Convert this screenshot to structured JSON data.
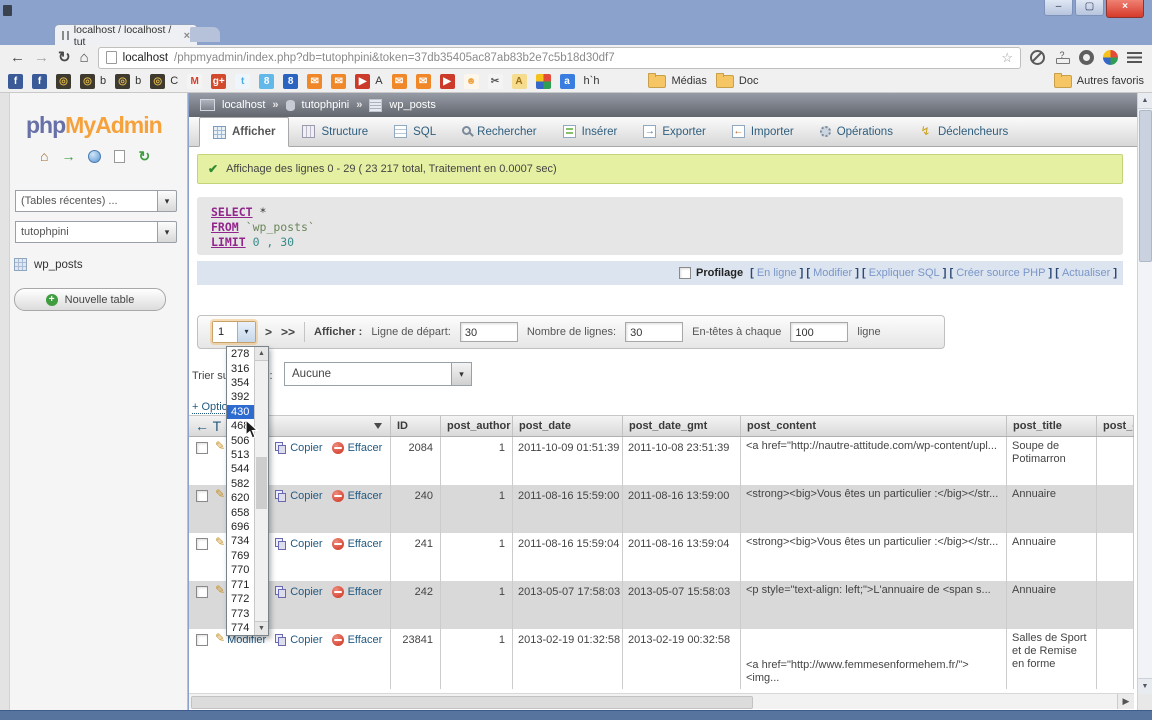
{
  "window": {
    "tab_title": "localhost / localhost / tut",
    "tab_close": "×",
    "minimize": "–",
    "maximize": "▢",
    "close": "×"
  },
  "browser": {
    "url_host": "localhost",
    "url_rest": "/phpmyadmin/index.php?db=tutophpini&token=37db35405ac87ab83b2e7c5b18d30df7",
    "bookmarks": [
      {
        "glyph": "f",
        "bg": "#3a5a98",
        "fg": "#ffffff"
      },
      {
        "glyph": "f",
        "bg": "#3a5a98",
        "fg": "#ffffff"
      },
      {
        "glyph": "◎",
        "bg": "#3f3a30",
        "fg": "#d8b44a"
      },
      {
        "glyph": "◎",
        "bg": "#3f3a30",
        "fg": "#d8b44a",
        "label": "b"
      },
      {
        "glyph": "◎",
        "bg": "#3f3a30",
        "fg": "#d8b44a",
        "label": "b"
      },
      {
        "glyph": "◎",
        "bg": "#3f3a30",
        "fg": "#d8b44a",
        "label": "C"
      },
      {
        "glyph": "M",
        "bg": "#f4f4f4",
        "fg": "#d43f2a"
      },
      {
        "glyph": "g+",
        "bg": "#d3492c",
        "fg": "#ffffff"
      },
      {
        "glyph": "t",
        "bg": "#eef6fc",
        "fg": "#4aabe4"
      },
      {
        "glyph": "8",
        "bg": "#62b8e8",
        "fg": "#ffffff"
      },
      {
        "glyph": "8",
        "bg": "#2a63c0",
        "fg": "#ffffff"
      },
      {
        "glyph": "✉",
        "bg": "#f0882a",
        "fg": "#ffffff"
      },
      {
        "glyph": "✉",
        "bg": "#f0882a",
        "fg": "#ffffff"
      },
      {
        "glyph": "▶",
        "bg": "#cc3a2a",
        "fg": "#ffffff",
        "label": "A"
      },
      {
        "glyph": "✉",
        "bg": "#f0882a",
        "fg": "#ffffff"
      },
      {
        "glyph": "✉",
        "bg": "#f0882a",
        "fg": "#ffffff"
      },
      {
        "glyph": "▶",
        "bg": "#cc3a2a",
        "fg": "#ffffff"
      },
      {
        "glyph": "☻",
        "bg": "#fdf6ec",
        "fg": "#f0a23a"
      },
      {
        "glyph": "✂",
        "bg": "#f4f4f4",
        "fg": "#555555"
      },
      {
        "glyph": "A",
        "bg": "#f6dc8e",
        "fg": "#a07010"
      },
      {
        "type": "grid"
      },
      {
        "glyph": "a",
        "bg": "#3a7de0",
        "fg": "#ffffff"
      },
      {
        "type": "text",
        "label": "h`h"
      }
    ],
    "folder_medias": "Médias",
    "folder_doc": "Doc",
    "other_favorites": "Autres favoris"
  },
  "sidebar": {
    "logo_php": "php",
    "logo_myadmin": "MyAdmin",
    "recent_tables": "(Tables récentes) ...",
    "database": "tutophpini",
    "table": "wp_posts",
    "new_table": "Nouvelle table"
  },
  "breadcrumb": {
    "server": "localhost",
    "sep": "»",
    "database": "tutophpini",
    "table": "wp_posts"
  },
  "tabs": [
    {
      "label": "Afficher",
      "icon": "browse",
      "active": true
    },
    {
      "label": "Structure",
      "icon": "structure"
    },
    {
      "label": "SQL",
      "icon": "sql"
    },
    {
      "label": "Rechercher",
      "icon": "search"
    },
    {
      "label": "Insérer",
      "icon": "insert"
    },
    {
      "label": "Exporter",
      "icon": "export"
    },
    {
      "label": "Importer",
      "icon": "import"
    },
    {
      "label": "Opérations",
      "icon": "ops"
    },
    {
      "label": "Déclencheurs",
      "icon": "triggers"
    }
  ],
  "message": "Affichage des lignes 0 - 29 ( 23 217 total, Traitement en 0.0007 sec)",
  "sql": {
    "kw_select": "SELECT",
    "star": "*",
    "kw_from": "FROM",
    "table": "`wp_posts`",
    "kw_limit": "LIMIT",
    "args": "0 , 30"
  },
  "profiling": {
    "label": "Profilage",
    "links": [
      "En ligne",
      "Modifier",
      "Expliquer SQL",
      "Créer source PHP",
      "Actualiser"
    ]
  },
  "pagination": {
    "select_value": "1",
    "next_label": ">",
    "last_label": ">>",
    "afficher_label": "Afficher :",
    "start_label": "Ligne de départ:",
    "start_value": "30",
    "rows_label": "Nombre de lignes:",
    "rows_value": "30",
    "headers_label": "En-têtes à chaque",
    "headers_value": "100",
    "ligne_label": "ligne"
  },
  "page_dropdown": {
    "options": [
      "278",
      "316",
      "354",
      "392",
      "430",
      "468",
      "506",
      "513",
      "544",
      "582",
      "620",
      "658",
      "696",
      "734",
      "769",
      "770",
      "771",
      "772",
      "773",
      "774"
    ],
    "selected": "430"
  },
  "sort": {
    "label": "Trier sur l'index :",
    "value": "Aucune"
  },
  "options_toggle": "+ Options",
  "results": {
    "options_header": "← T →",
    "columns": [
      "ID",
      "post_author",
      "post_date",
      "post_date_gmt",
      "post_content",
      "post_title",
      "post_e"
    ],
    "actions": {
      "edit": "Modifier",
      "copy": "Copier",
      "delete": "Effacer"
    },
    "rows": [
      {
        "id": "2084",
        "author": "1",
        "date": "2011-10-09 01:51:39",
        "date_gmt": "2011-10-08 23:51:39",
        "content": "<a href=\"http://nautre-attitude.com/wp-content/upl...",
        "title": "Soupe de Potimarron"
      },
      {
        "id": "240",
        "author": "1",
        "date": "2011-08-16 15:59:00",
        "date_gmt": "2011-08-16 13:59:00",
        "content": "<strong><big>Vous êtes un particulier :</big></str...",
        "title": "Annuaire"
      },
      {
        "id": "241",
        "author": "1",
        "date": "2011-08-16 15:59:04",
        "date_gmt": "2011-08-16 13:59:04",
        "content": "<strong><big>Vous êtes un particulier :</big></str...",
        "title": "Annuaire"
      },
      {
        "id": "242",
        "author": "1",
        "date": "2013-05-07 17:58:03",
        "date_gmt": "2013-05-07 15:58:03",
        "content": "<p style=\"text-align: left;\">L'annuaire de <span s...",
        "title": "Annuaire"
      },
      {
        "id": "23841",
        "author": "1",
        "date": "2013-02-19 01:32:58",
        "date_gmt": "2013-02-19 00:32:58",
        "content": "<a href=\"http://www.femmesenformehem.fr/\"> <img...",
        "title": "Salles de Sport et de Remise en forme"
      }
    ]
  }
}
